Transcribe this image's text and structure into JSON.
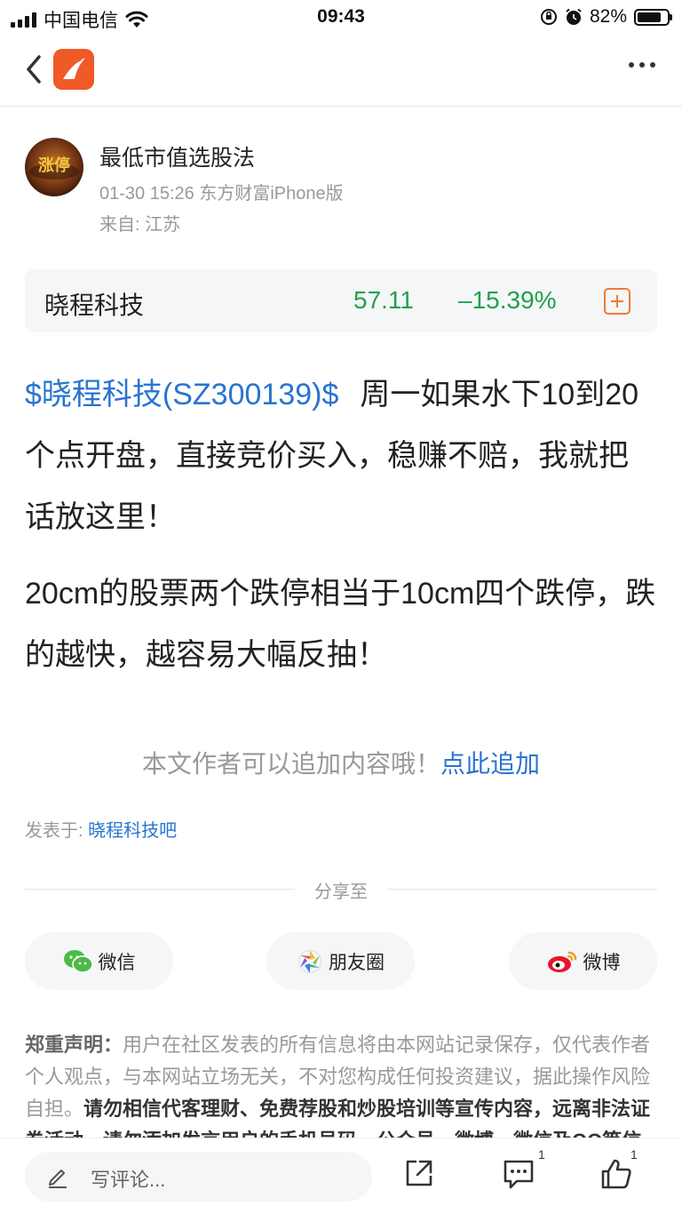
{
  "status": {
    "carrier": "中国电信",
    "time": "09:43",
    "battery": "82%",
    "battery_level": 0.82
  },
  "author": {
    "name": "最低市值选股法",
    "meta": "01-30 15:26 东方财富iPhone版",
    "origin": "来自: 江苏",
    "avatar_text": "涨停"
  },
  "stock": {
    "name": "晓程科技",
    "price": "57.11",
    "change": "–15.39%"
  },
  "post": {
    "stock_link": "$晓程科技(SZ300139)$",
    "para1_text": "周一如果水下10到20个点开盘，直接竞价买入，稳赚不赔，我就把话放这里！",
    "para2": "20cm的股票两个跌停相当于10cm四个跌停，跌的越快，越容易大幅反抽！"
  },
  "append": {
    "text": "本文作者可以追加内容哦！",
    "link": "点此追加"
  },
  "posted": {
    "label": "发表于: ",
    "forum": "晓程科技吧"
  },
  "share": {
    "title": "分享至",
    "wechat": "微信",
    "moments": "朋友圈",
    "weibo": "微博"
  },
  "disclaimer": {
    "label": "郑重声明：",
    "text": "用户在社区发表的所有信息将由本网站记录保存，仅代表作者个人观点，与本网站立场无关，不对您构成任何投资建议，据此操作风险自担。",
    "strong": "请勿相信代客理财、免费荐股和炒股培训等宣传内容，远离非法证券活动。请勿添加发言用户的手机号码、公众号、微博、微信及QQ等信息，谨防上当受骗！"
  },
  "bottom": {
    "comment_placeholder": "写评论...",
    "comments_count": "1",
    "likes_count": "1"
  },
  "colors": {
    "accent_blue": "#2a74d0",
    "down_green": "#22a04b",
    "brand_orange": "#ef5a28"
  }
}
